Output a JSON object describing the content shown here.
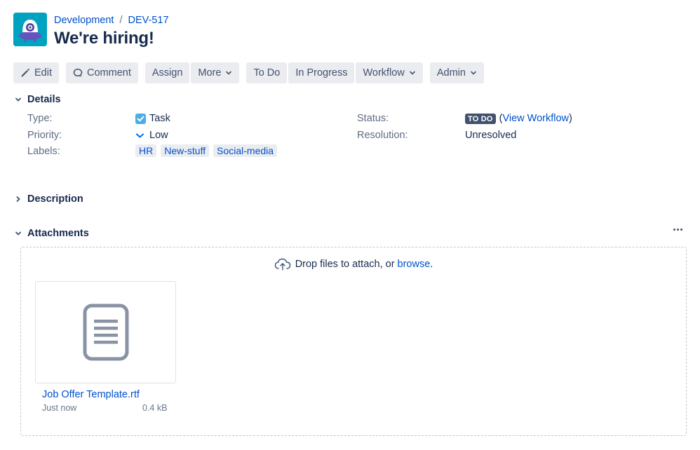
{
  "breadcrumb": {
    "project": "Development",
    "separator": "/",
    "issue_key": "DEV-517"
  },
  "title": "We're hiring!",
  "toolbar": {
    "edit": "Edit",
    "comment": "Comment",
    "assign": "Assign",
    "more": "More",
    "todo": "To Do",
    "in_progress": "In Progress",
    "workflow": "Workflow",
    "admin": "Admin"
  },
  "sections": {
    "details": "Details",
    "description": "Description",
    "attachments": "Attachments"
  },
  "details": {
    "type_label": "Type:",
    "type_value": "Task",
    "priority_label": "Priority:",
    "priority_value": "Low",
    "labels_label": "Labels:",
    "labels": [
      "HR",
      "New-stuff",
      "Social-media"
    ],
    "status_label": "Status:",
    "status_value": "TO DO",
    "status_open": "(",
    "view_workflow": "View Workflow",
    "status_close": ")",
    "resolution_label": "Resolution:",
    "resolution_value": "Unresolved"
  },
  "attachments": {
    "drop_text": "Drop files to attach, or ",
    "browse": "browse",
    "drop_end": ".",
    "file_name": "Job Offer Template.rtf",
    "file_time": "Just now",
    "file_size": "0.4 kB"
  },
  "colors": {
    "accent": "#0052cc",
    "button_bg": "#ebecf0",
    "lozenge_bg": "#42526e",
    "avatar_bg": "#00a3bf"
  }
}
